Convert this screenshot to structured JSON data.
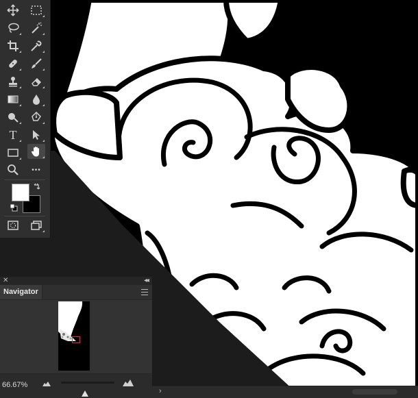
{
  "toolbar": {
    "tools": [
      {
        "name": "move-tool",
        "icon": "move-icon"
      },
      {
        "name": "marquee-tool",
        "icon": "rect-marquee-icon"
      },
      {
        "name": "lasso-tool",
        "icon": "lasso-icon"
      },
      {
        "name": "magic-wand-tool",
        "icon": "magic-wand-icon"
      },
      {
        "name": "crop-tool",
        "icon": "crop-icon"
      },
      {
        "name": "eyedropper-tool",
        "icon": "eyedropper-icon"
      },
      {
        "name": "healing-brush-tool",
        "icon": "bandage-icon"
      },
      {
        "name": "brush-tool",
        "icon": "brush-icon"
      },
      {
        "name": "clone-stamp-tool",
        "icon": "stamp-icon"
      },
      {
        "name": "eraser-tool",
        "icon": "eraser-icon"
      },
      {
        "name": "gradient-tool",
        "icon": "gradient-icon"
      },
      {
        "name": "blur-tool",
        "icon": "drop-icon"
      },
      {
        "name": "dodge-tool",
        "icon": "dodge-icon"
      },
      {
        "name": "pen-tool",
        "icon": "pen-icon"
      },
      {
        "name": "type-tool",
        "icon": "type-icon",
        "glyph": "T"
      },
      {
        "name": "path-selection-tool",
        "icon": "arrow-icon"
      },
      {
        "name": "shape-tool",
        "icon": "rectangle-icon"
      },
      {
        "name": "hand-tool",
        "icon": "hand-icon",
        "active": true
      },
      {
        "name": "zoom-tool",
        "icon": "zoom-icon"
      },
      {
        "name": "more-tools",
        "icon": "ellipsis-icon",
        "glyph": "•••"
      }
    ],
    "foreground_color": "#ffffff",
    "background_color": "#000000"
  },
  "navigator": {
    "tab_label": "Navigator",
    "zoom_value": "66.67%",
    "zoom_fraction": 0.45
  },
  "colors": {
    "panel": "#3a3a3a",
    "toolbar": "#2f2f2f",
    "pasteboard": "#1b1b1b",
    "viewbox": "#e03030"
  }
}
